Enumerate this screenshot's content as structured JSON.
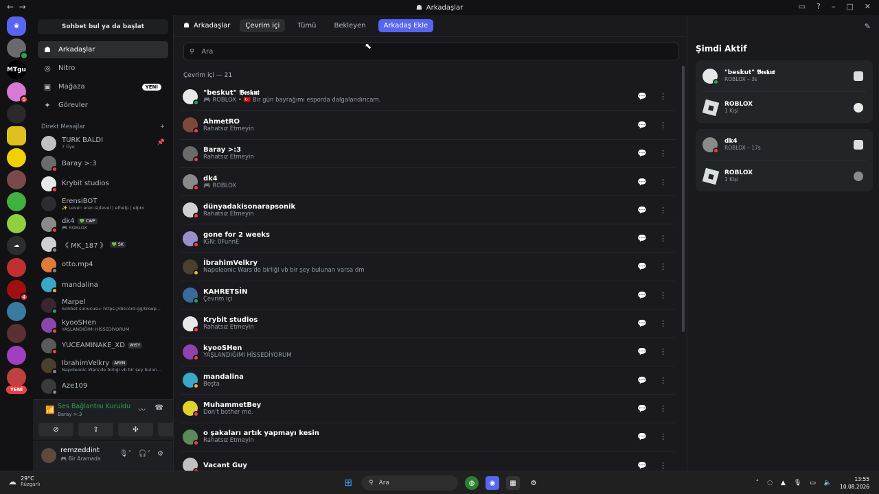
{
  "window": {
    "title": "Arkadaşlar"
  },
  "sidebar": {
    "search_label": "Sohbet bul ya da başlat",
    "nav": [
      {
        "label": "Arkadaşlar",
        "icon": "friends-icon"
      },
      {
        "label": "Nitro",
        "icon": "nitro-icon"
      },
      {
        "label": "Mağaza",
        "icon": "shop-icon",
        "badge": "YENİ"
      },
      {
        "label": "Görevler",
        "icon": "quests-icon"
      }
    ],
    "dm_header": "Direkt Mesajlar",
    "dm_add": "+",
    "dms": [
      {
        "name": "TÜRK BALDİ",
        "sub": "7 Üye",
        "status": "none",
        "color": "#c0c0c0"
      },
      {
        "name": "Baray >:3",
        "sub": "",
        "status": "dnd",
        "color": "#6b6b6b"
      },
      {
        "name": "Krybit studios",
        "sub": "",
        "status": "dnd",
        "color": "#e8e8e8"
      },
      {
        "name": "ErensiBOT",
        "sub": "✨ Level: eren.si/level | elhelp | elpro",
        "status": "none",
        "color": "#2b2d31"
      },
      {
        "name": "dk4",
        "tag": "💚 CWP",
        "sub": "🎮 ROBLOX",
        "status": "dnd",
        "color": "#8a8a8a"
      },
      {
        "name": "《 MK_187 》",
        "tag": "💚 SK",
        "sub": "",
        "status": "off",
        "color": "#d0d0d0"
      },
      {
        "name": "otto.mp4",
        "sub": "",
        "status": "off",
        "color": "#e07b39"
      },
      {
        "name": "mandalina",
        "sub": "",
        "status": "idle",
        "color": "#3aa6c8"
      },
      {
        "name": "Marpel",
        "sub": "Sohbet sunucusu: https://discord.gg/Gkwp...",
        "status": "on",
        "color": "#3a2530"
      },
      {
        "name": "kyooSHen",
        "sub": "YAŞLANDIĞIMI HİSSEDİYORUM",
        "status": "dnd",
        "color": "#8e44ad"
      },
      {
        "name": "YUCEAMİNAKE_XD",
        "tag": "WISY",
        "sub": "",
        "status": "dnd",
        "color": "#5a5a5a"
      },
      {
        "name": "İbrahimVelkry",
        "tag": "ARYN",
        "sub": "Napoleonic Wars'de birliği vb bir şey bulun...",
        "status": "off",
        "color": "#4a4030"
      },
      {
        "name": "Aze109",
        "sub": "",
        "status": "off",
        "color": "#3a3a3a"
      }
    ]
  },
  "servers": {
    "badges": [
      "5",
      "4"
    ],
    "labels": [
      "MTgu"
    ],
    "new_pill": "YENİ"
  },
  "voice": {
    "title": "Ses Bağlantısı Kuruldu",
    "sub": "Baray >:3"
  },
  "user": {
    "name": "remzeddint",
    "status": "🎮 Bir Aramada"
  },
  "topbar": {
    "title": "Arkadaşlar",
    "tabs": [
      "Çevrim içi",
      "Tümü",
      "Bekleyen"
    ],
    "add_friend": "Arkadaş Ekle"
  },
  "search": {
    "placeholder": "Ara"
  },
  "section_label": "Çevrim içi — 21",
  "friends": [
    {
      "name": "\"beskut\" 𝕭𝖊𝖘𝖐𝖚𝖙",
      "sub": "🎮 ROBLOX • 🇹🇷 Bir gün bayrağımı esporda dalgalandırıcam.",
      "status": "on",
      "color": "#e8e8e8"
    },
    {
      "name": "AhmetRO",
      "sub": "Rahatsız Etmeyin",
      "status": "dnd",
      "color": "#7a4a3a"
    },
    {
      "name": "Baray >:3",
      "sub": "Rahatsız Etmeyin",
      "status": "dnd",
      "color": "#6b6b6b"
    },
    {
      "name": "dk4",
      "sub": "🎮 ROBLOX",
      "status": "dnd",
      "color": "#8a8a8a"
    },
    {
      "name": "dünyadakisonarapsonik",
      "sub": "Rahatsız Etmeyin",
      "status": "dnd",
      "color": "#d0d0d0"
    },
    {
      "name": "gone for 2 weeks",
      "sub": "IGN: 0FunnE",
      "status": "dnd",
      "color": "#9b8ec9"
    },
    {
      "name": "İbrahimVelkry",
      "sub": "Napoleonic Wars'de birliği vb bir şey bulunan varsa dm",
      "status": "idle",
      "color": "#4a4030"
    },
    {
      "name": "KAHRETSİN",
      "sub": "Çevrim içi",
      "status": "on",
      "color": "#3a6a9a"
    },
    {
      "name": "Krybit studios",
      "sub": "Rahatsız Etmeyin",
      "status": "dnd",
      "color": "#e8e8e8"
    },
    {
      "name": "kyooSHen",
      "sub": "YAŞLANDIĞIMI HİSSEDİYORUM",
      "status": "dnd",
      "color": "#8e44ad"
    },
    {
      "name": "mandalina",
      "sub": "Boşta",
      "status": "idle",
      "color": "#3aa6c8"
    },
    {
      "name": "MuhammetBey",
      "sub": "Don't bother me.",
      "status": "dnd",
      "color": "#e0d030"
    },
    {
      "name": "o şakaları artık yapmayı kesin",
      "sub": "Rahatsız Etmeyin",
      "status": "dnd",
      "color": "#5a8a5a"
    },
    {
      "name": "Vacant Guy",
      "sub": "",
      "status": "dnd",
      "color": "#c0c0c0"
    }
  ],
  "active_now": {
    "title": "Şimdi Aktif",
    "cards": [
      {
        "user": "\"beskut\" 𝕭𝖊𝖘𝖐𝖚𝖙",
        "user_sub": "ROBLOX – 3s",
        "game": "ROBLOX",
        "game_sub": "1 Kişi",
        "status": "on"
      },
      {
        "user": "dk4",
        "user_sub": "ROBLOX – 17s",
        "game": "ROBLOX",
        "game_sub": "1 Kişi",
        "status": "dnd"
      }
    ]
  },
  "taskbar": {
    "temp": "29°C",
    "weather": "Rüzgarlı",
    "search": "Ara",
    "time": "13:55",
    "date": "10.08.2026"
  },
  "colors": {
    "accent": "#5865f2",
    "online": "#23a55a",
    "dnd": "#f23f43",
    "idle": "#f0b232"
  }
}
